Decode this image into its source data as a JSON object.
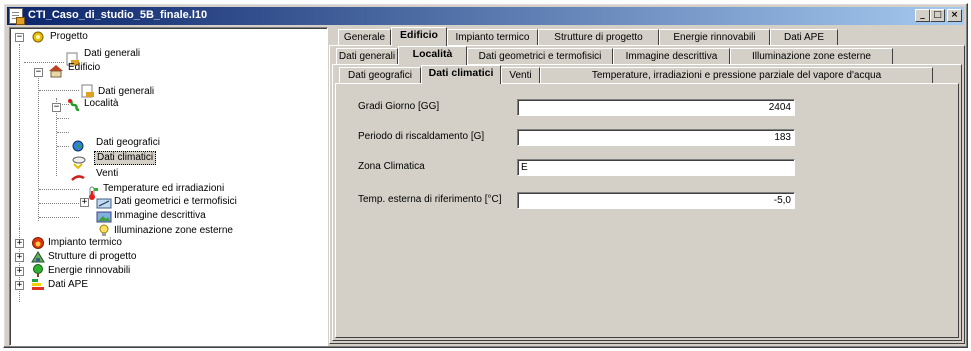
{
  "window": {
    "title": "CTI_Caso_di_studio_5B_finale.l10",
    "controls": {
      "minimize": "_",
      "maximize": "□",
      "close": "×"
    }
  },
  "tree": {
    "root": "Progetto",
    "nodes": {
      "dati_generali_progetto": "Dati generali",
      "edificio": "Edificio",
      "dati_generali_edificio": "Dati generali",
      "localita": "Località",
      "dati_geografici": "Dati geografici",
      "dati_climatici": "Dati climatici",
      "venti": "Venti",
      "temperature": "Temperature ed irradiazioni",
      "dati_geometrici": "Dati geometrici e termofisici",
      "immagine": "Immagine descrittiva",
      "illuminazione": "Illuminazione zone esterne",
      "impianto": "Impianto termico",
      "strutture": "Strutture di progetto",
      "energie": "Energie rinnovabili",
      "dati_ape": "Dati APE"
    },
    "selected": "Dati climatici"
  },
  "tabs_level1": [
    "Generale",
    "Edificio",
    "Impianto termico",
    "Strutture di progetto",
    "Energie rinnovabili",
    "Dati APE"
  ],
  "tabs_level2": [
    "Dati generali",
    "Località",
    "Dati geometrici e termofisici",
    "Immagine descrittiva",
    "Illuminazione zone esterne"
  ],
  "tabs_level3": [
    "Dati geografici",
    "Dati climatici",
    "Venti",
    "Temperature, irradiazioni e pressione parziale del vapore d'acqua"
  ],
  "form": {
    "gradi_giorno": {
      "label": "Gradi Giorno [GG]",
      "value": "2404"
    },
    "periodo": {
      "label": "Periodo di riscaldamento [G]",
      "value": "183"
    },
    "zona": {
      "label": "Zona Climatica",
      "value": "E"
    },
    "temp_esterna": {
      "label": "Temp. esterna di riferimento [°C]",
      "value": "-5,0"
    }
  },
  "colors": {
    "titlebar_start": "#0a246a",
    "titlebar_end": "#a6caf0",
    "face": "#d4d0c8"
  }
}
